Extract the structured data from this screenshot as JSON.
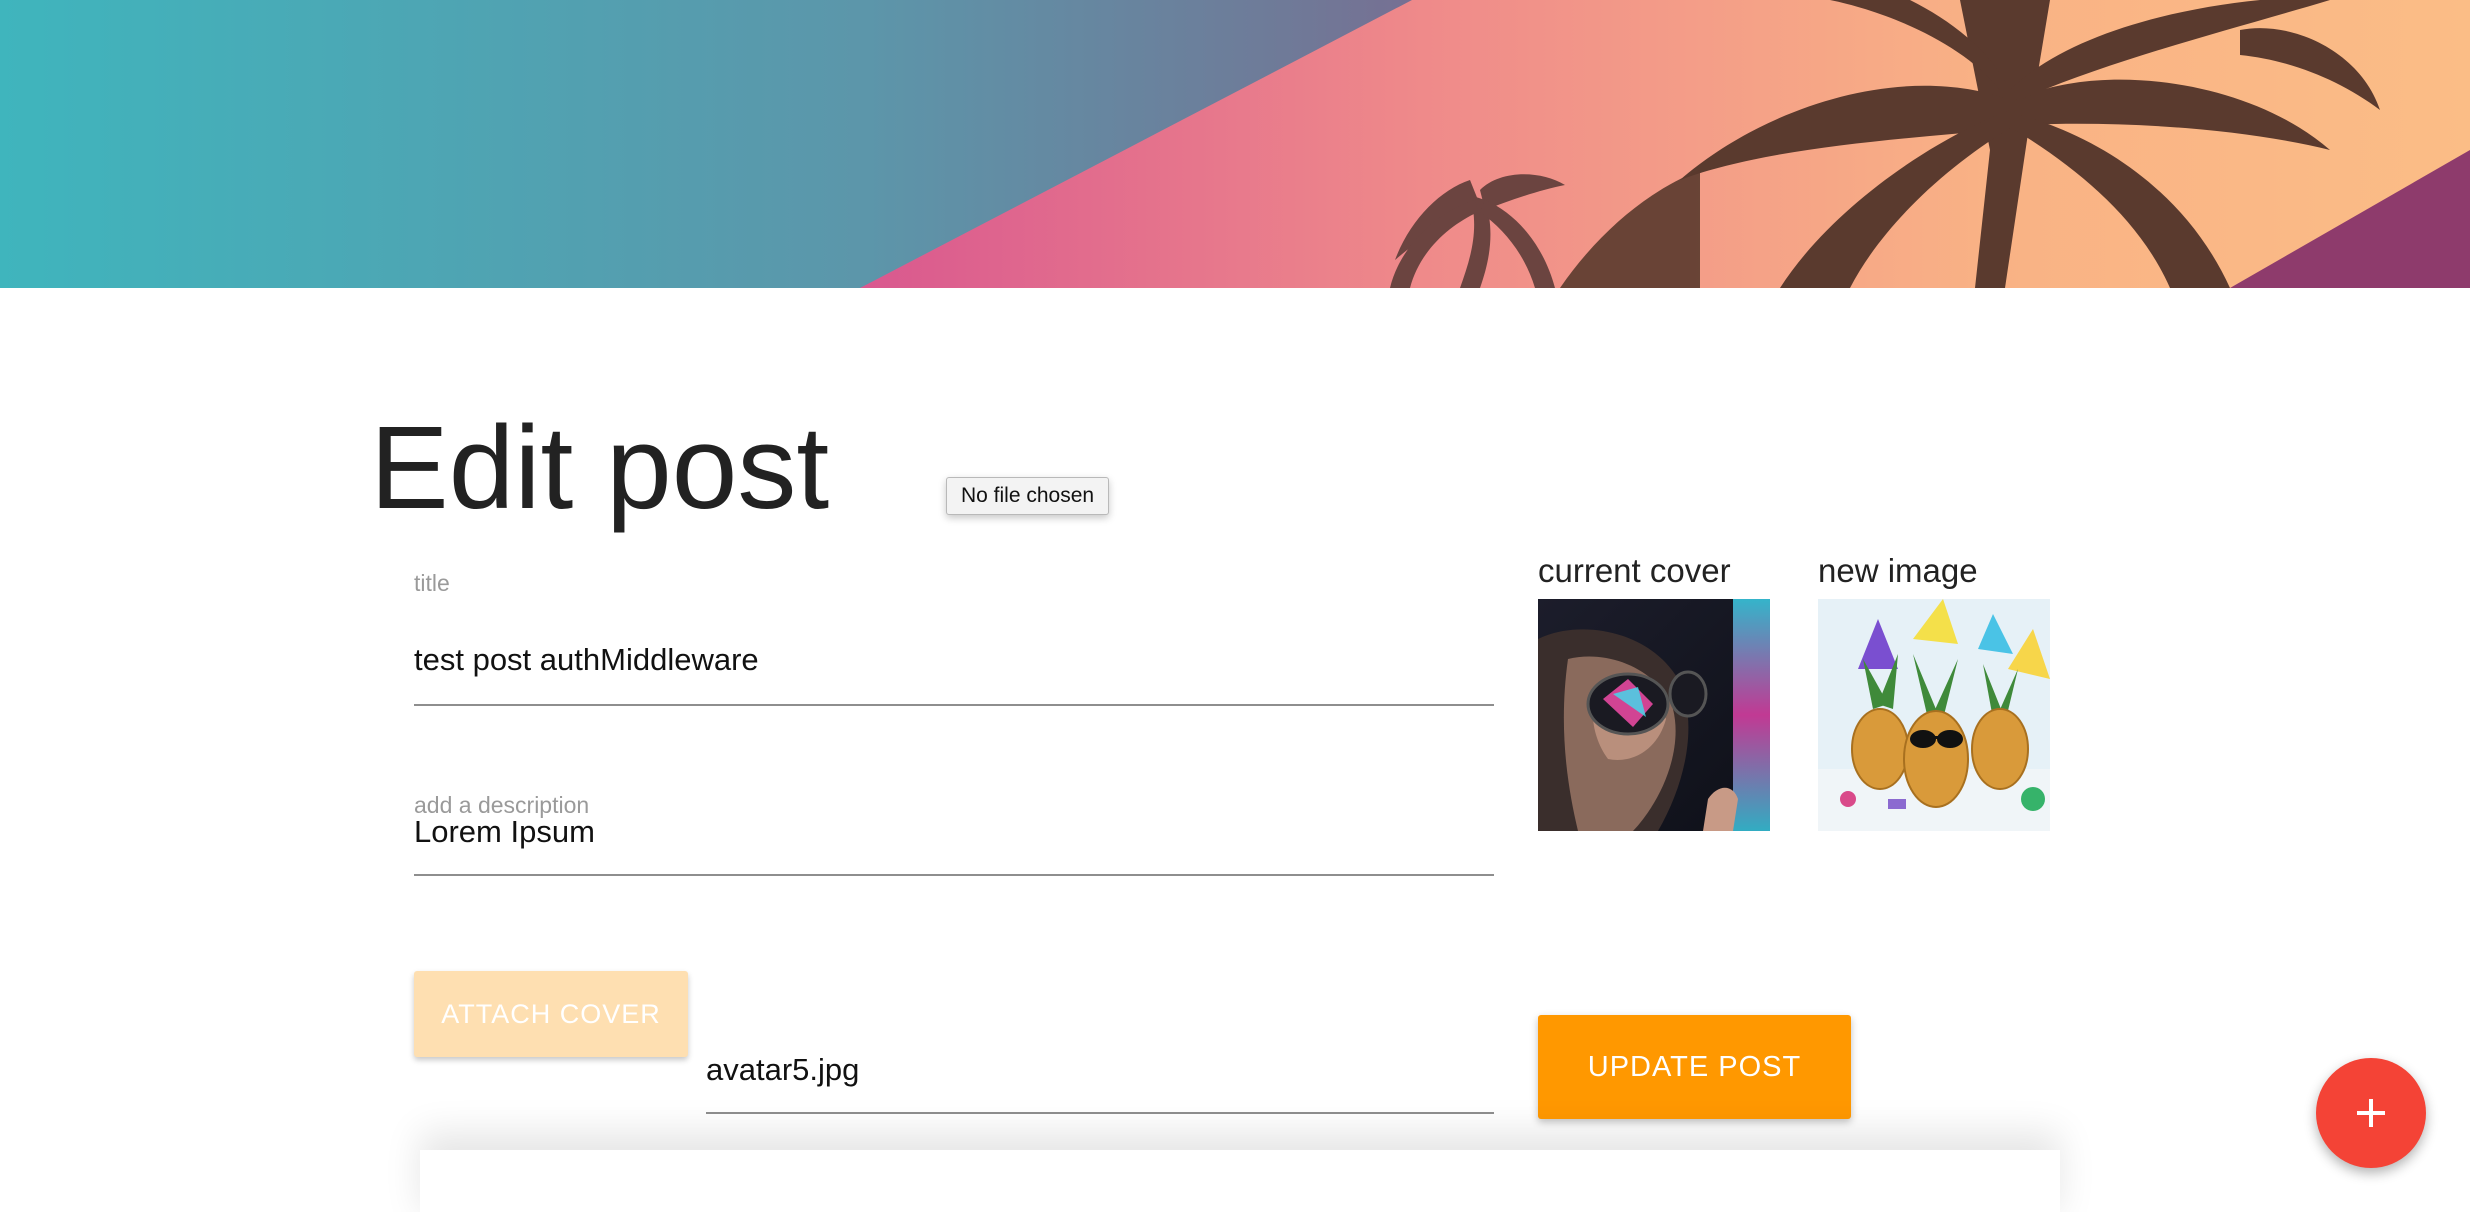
{
  "page": {
    "title": "Edit post"
  },
  "file_input": {
    "status_text": "No file chosen"
  },
  "form": {
    "title_label": "title",
    "title_value": "test post authMiddleware",
    "description_placeholder": "add a description",
    "description_value": "Lorem Ipsum",
    "attach_label": "ATTACH COVER",
    "file_name": "avatar5.jpg",
    "update_label": "UPDATE POST"
  },
  "previews": {
    "current_label": "current cover",
    "new_label": "new image"
  },
  "icons": {
    "fab": "plus-icon"
  },
  "colors": {
    "accent": "#ff9800",
    "accent_disabled": "#fedfb1",
    "fab": "#f44336",
    "hero_teal": "#3fb5bd",
    "hero_pink": "#d9588f",
    "hero_peach": "#f9b285"
  }
}
